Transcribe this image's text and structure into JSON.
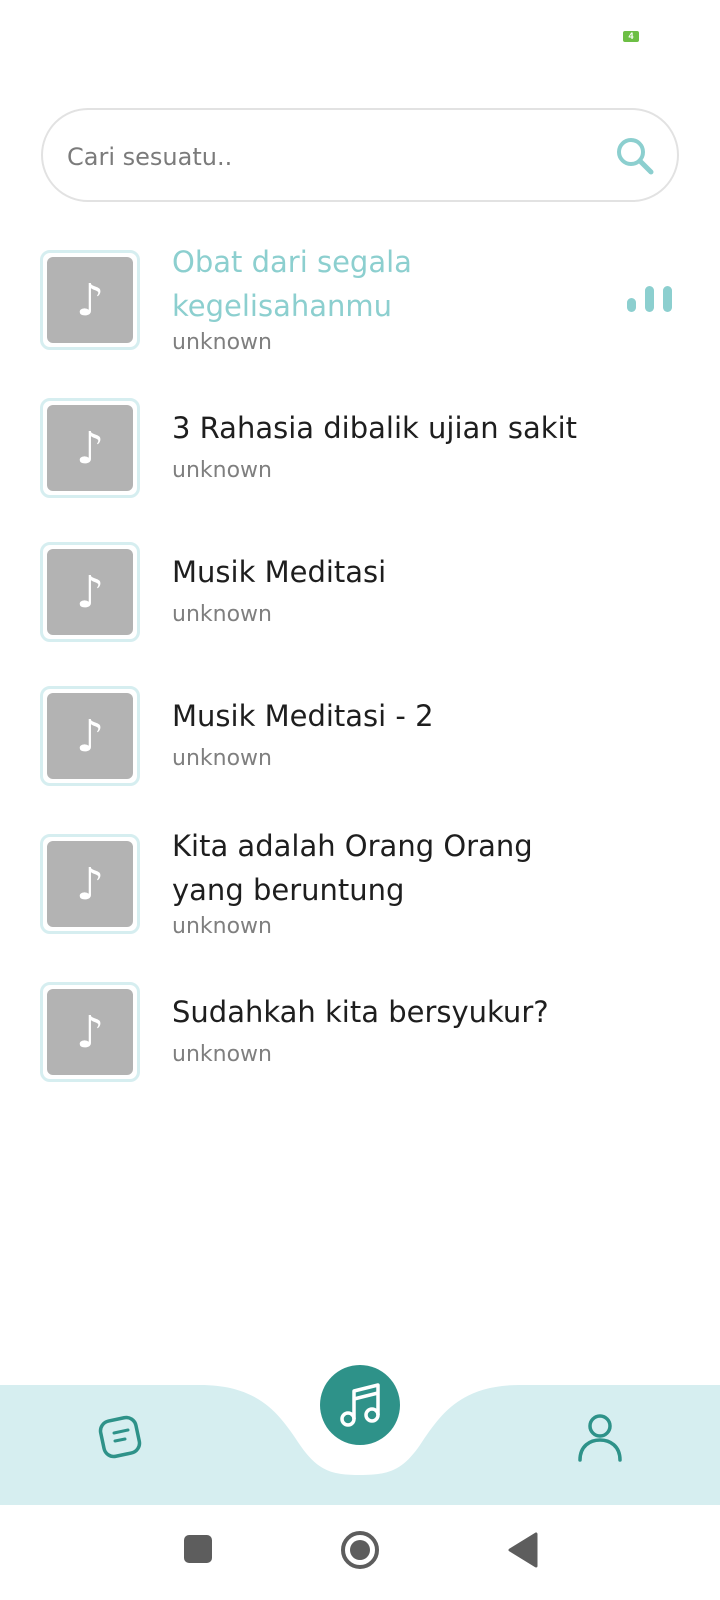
{
  "status_bar": {
    "battery_level": "4",
    "battery_color": "#6dbf45"
  },
  "search": {
    "placeholder": "Cari sesuatu..",
    "value": "",
    "icon": "search-icon"
  },
  "tracks": [
    {
      "title": "Obat dari segala kegelisahanmu",
      "artist": "unknown",
      "playing": true
    },
    {
      "title": "3 Rahasia dibalik ujian sakit",
      "artist": "unknown",
      "playing": false
    },
    {
      "title": "Musik Meditasi",
      "artist": "unknown",
      "playing": false
    },
    {
      "title": "Musik Meditasi - 2",
      "artist": "unknown",
      "playing": false
    },
    {
      "title": "Kita adalah Orang Orang yang beruntung",
      "artist": "unknown",
      "playing": false
    },
    {
      "title": "Sudahkah kita bersyukur?",
      "artist": "unknown",
      "playing": false
    }
  ],
  "bottom_nav": {
    "items": [
      {
        "icon": "sticker-notes-icon",
        "active": false
      },
      {
        "icon": "music-note-icon",
        "active": true
      },
      {
        "icon": "user-profile-icon",
        "active": false
      }
    ],
    "background_color": "#d6eef0",
    "active_color": "#2e9289"
  },
  "system_nav": {
    "items": [
      "recent-apps-icon",
      "home-icon",
      "back-icon"
    ]
  },
  "colors": {
    "accent": "#8ccfcf",
    "thumb_placeholder": "#b3b3b3",
    "thumb_border": "#d6eef0"
  }
}
